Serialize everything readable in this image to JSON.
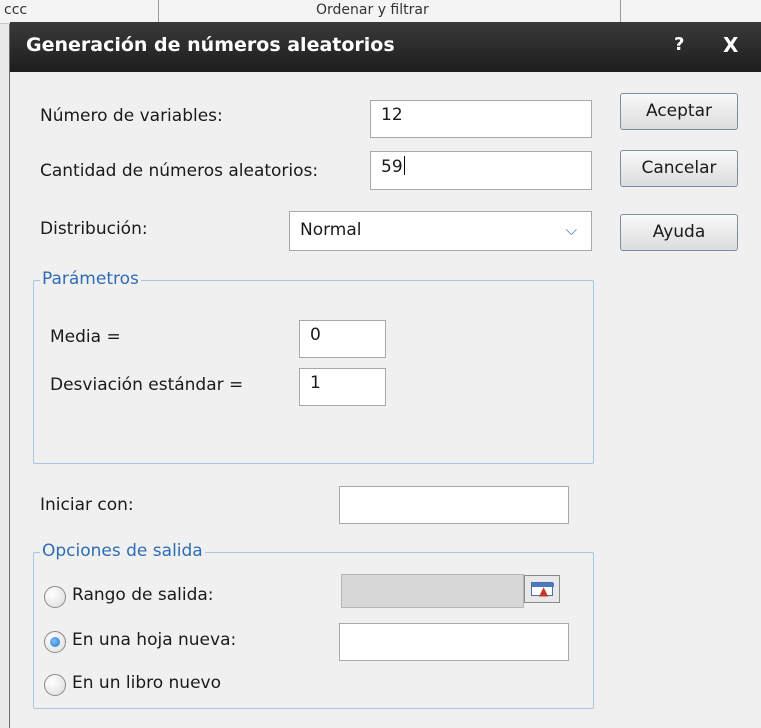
{
  "background": {
    "strip_texts": [
      "ccc",
      "Ordenar y filtrar"
    ]
  },
  "dialog": {
    "title": "Generación de números aleatorios",
    "help_glyph": "?",
    "close_glyph": "X"
  },
  "fields": {
    "num_variables": {
      "label": "Número de variables:",
      "value": "12"
    },
    "cantidad": {
      "label": "Cantidad de números aleatorios:",
      "value": "59"
    },
    "distribucion": {
      "label": "Distribución:",
      "value": "Normal"
    }
  },
  "buttons": {
    "aceptar": "Aceptar",
    "cancelar": "Cancelar",
    "ayuda": "Ayuda"
  },
  "parametros": {
    "legend": "Parámetros",
    "media": {
      "label": "Media =",
      "value": "0"
    },
    "desviacion": {
      "label": "Desviación estándar =",
      "value": "1"
    }
  },
  "iniciar": {
    "label": "Iniciar con:",
    "value": ""
  },
  "salida": {
    "legend": "Opciones de salida",
    "options": [
      {
        "label": "Rango de salida:",
        "checked": false
      },
      {
        "label": "En una hoja nueva:",
        "checked": true
      },
      {
        "label": "En un libro nuevo",
        "checked": false
      }
    ],
    "rango_value": "",
    "hoja_value": ""
  },
  "colors": {
    "titlebar": "#1d1d1d",
    "group_border": "#a9c6e3",
    "group_legend": "#2f6cb5",
    "radio_selected": "#1f6fc7"
  },
  "icons": [
    "help-icon",
    "close-icon",
    "chevron-down-icon",
    "range-selector-icon"
  ]
}
